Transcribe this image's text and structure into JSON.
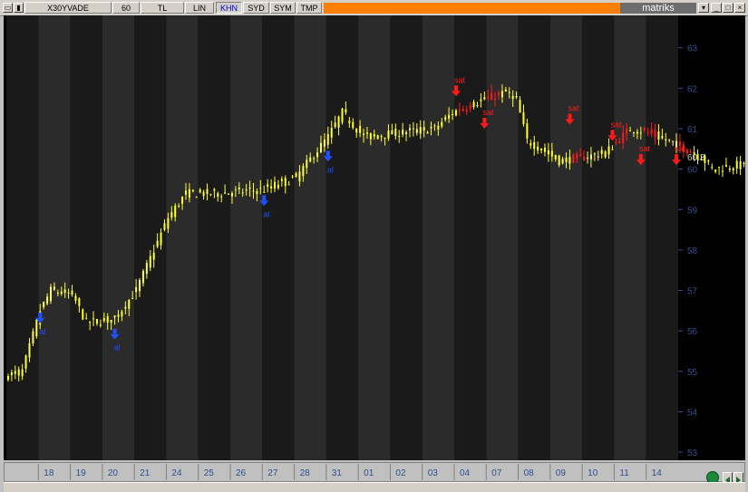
{
  "toolbar": {
    "symbol": "X30YVADE",
    "interval": "60",
    "buttons": [
      "TL",
      "LIN",
      "KHN",
      "SYD",
      "SYM",
      "TMP"
    ],
    "active_button": "KHN",
    "brand": "matriks"
  },
  "colors": {
    "background": "#000000",
    "band_dark": "#1a1a1a",
    "band_light": "#2b2b2b",
    "candle": "#ffff33",
    "sell_signal": "#ff1a1a",
    "buy_signal": "#1f4fff",
    "axis_text": "#2f4f8f"
  },
  "chart_data": {
    "type": "candlestick",
    "title": "",
    "y_axis": {
      "position": "right",
      "min": 52.8,
      "max": 63.8,
      "ticks": [
        53,
        54,
        55,
        56,
        57,
        58,
        59,
        60,
        61,
        62,
        63
      ]
    },
    "last_value": "60.3",
    "x_axis": {
      "labels": [
        "18",
        "19",
        "20",
        "21",
        "24",
        "25",
        "26",
        "27",
        "28",
        "31",
        "01",
        "02",
        "03",
        "04",
        "07",
        "08",
        "09",
        "10",
        "11",
        "14"
      ]
    },
    "bars_per_session": 9,
    "price_path": [
      [
        0,
        54.9
      ],
      [
        4,
        55.0
      ],
      [
        9,
        56.5
      ],
      [
        12,
        57.0
      ],
      [
        18,
        56.9
      ],
      [
        22,
        56.2
      ],
      [
        30,
        56.3
      ],
      [
        36,
        57.0
      ],
      [
        45,
        58.8
      ],
      [
        50,
        59.4
      ],
      [
        60,
        59.4
      ],
      [
        72,
        59.5
      ],
      [
        81,
        59.8
      ],
      [
        90,
        60.8
      ],
      [
        94,
        61.4
      ],
      [
        100,
        60.8
      ],
      [
        110,
        60.9
      ],
      [
        120,
        61.0
      ],
      [
        125,
        61.4
      ],
      [
        133,
        61.7
      ],
      [
        140,
        61.9
      ],
      [
        143,
        61.7
      ],
      [
        146,
        60.7
      ],
      [
        150,
        60.5
      ],
      [
        155,
        60.2
      ],
      [
        162,
        60.3
      ],
      [
        168,
        60.4
      ],
      [
        175,
        61.0
      ],
      [
        180,
        60.9
      ],
      [
        188,
        60.6
      ],
      [
        195,
        60.3
      ],
      [
        198,
        60.0
      ],
      [
        205,
        60.1
      ],
      [
        210,
        60.0
      ],
      [
        212,
        59.2
      ],
      [
        220,
        59.5
      ],
      [
        226,
        59.4
      ],
      [
        230,
        59.8
      ],
      [
        234,
        59.3
      ],
      [
        240,
        59.0
      ],
      [
        250,
        58.6
      ],
      [
        260,
        58.5
      ],
      [
        270,
        58.7
      ],
      [
        275,
        58.9
      ],
      [
        285,
        58.6
      ],
      [
        290,
        58.2
      ],
      [
        295,
        57.7
      ],
      [
        300,
        57.9
      ],
      [
        305,
        58.0
      ],
      [
        310,
        57.6
      ],
      [
        318,
        57.5
      ],
      [
        325,
        57.3
      ],
      [
        330,
        57.1
      ],
      [
        338,
        57.0
      ],
      [
        345,
        57.1
      ],
      [
        350,
        57.3
      ],
      [
        355,
        57.0
      ],
      [
        360,
        56.6
      ],
      [
        364,
        56.8
      ],
      [
        368,
        57.6
      ],
      [
        372,
        58.3
      ],
      [
        376,
        58.8
      ],
      [
        380,
        59.2
      ],
      [
        385,
        59.4
      ],
      [
        390,
        59.5
      ],
      [
        395,
        59.5
      ],
      [
        398,
        59.1
      ]
    ],
    "signals": [
      {
        "type": "buy",
        "label": "al",
        "bar": 9,
        "price": 56.5
      },
      {
        "type": "buy",
        "label": "al",
        "bar": 30,
        "price": 56.1
      },
      {
        "type": "buy",
        "label": "al",
        "bar": 72,
        "price": 59.4
      },
      {
        "type": "buy",
        "label": "al",
        "bar": 90,
        "price": 60.5
      },
      {
        "type": "buy",
        "label": "al",
        "bar": 362,
        "price": 56.6
      },
      {
        "type": "sell",
        "label": "sat",
        "bar": 126,
        "price": 61.8
      },
      {
        "type": "sell",
        "label": "sat",
        "bar": 134,
        "price": 61.0
      },
      {
        "type": "sell",
        "label": "sat",
        "bar": 158,
        "price": 61.1
      },
      {
        "type": "sell",
        "label": "sat",
        "bar": 170,
        "price": 60.7
      },
      {
        "type": "sell",
        "label": "sat",
        "bar": 178,
        "price": 60.1
      },
      {
        "type": "sell",
        "label": "sat",
        "bar": 188,
        "price": 60.1
      },
      {
        "type": "sell",
        "label": "sat",
        "bar": 215,
        "price": 59.6
      },
      {
        "type": "sell",
        "label": "sat",
        "bar": 261,
        "price": 58.8
      },
      {
        "type": "sell",
        "label": "sat",
        "bar": 277,
        "price": 58.0
      },
      {
        "type": "sell",
        "label": "sat",
        "bar": 285,
        "price": 57.8
      },
      {
        "type": "sell",
        "label": "sat",
        "bar": 304,
        "price": 57.7
      },
      {
        "type": "sell",
        "label": "sat",
        "bar": 322,
        "price": 57.7
      }
    ]
  }
}
